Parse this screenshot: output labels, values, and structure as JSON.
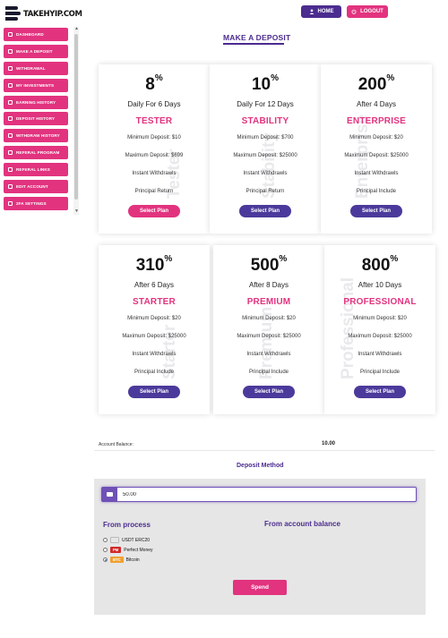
{
  "header": {
    "logo_text": "TAKEHYIP.COM",
    "home_label": "HOME",
    "logout_label": "LOGOUT"
  },
  "sidebar": {
    "items": [
      {
        "label": "DASHBOARD",
        "icon": "dashboard-icon"
      },
      {
        "label": "MAKE A DEPOSIT",
        "icon": "deposit-icon"
      },
      {
        "label": "WITHDRAWAL",
        "icon": "withdrawal-icon"
      },
      {
        "label": "MY INVESTMENTS",
        "icon": "investments-icon"
      },
      {
        "label": "EARNING HISTORY",
        "icon": "earning-icon"
      },
      {
        "label": "DEPOSIT HISTORY",
        "icon": "history-icon"
      },
      {
        "label": "WITHDRAW HISTORY",
        "icon": "history-icon"
      },
      {
        "label": "REFERAL PROGRAM",
        "icon": "referral-icon"
      },
      {
        "label": "REFERAL LINKS",
        "icon": "link-icon"
      },
      {
        "label": "EDIT ACCOUNT",
        "icon": "edit-icon"
      },
      {
        "label": "2FA SETTINGS",
        "icon": "lock-icon"
      }
    ]
  },
  "page_title": "MAKE A DEPOSIT",
  "plans": [
    {
      "percent": "8",
      "duration": "Daily For 6 Days",
      "name": "TESTER",
      "min": "Minimum Deposit: $10",
      "max": "Maximum Deposit: $699",
      "withdraw": "Instant Withdrawls",
      "principal": "Principal Return",
      "button": "Select Plan",
      "watermark": "Tester",
      "button_color": "#e2337f"
    },
    {
      "percent": "10",
      "duration": "Daily For 12 Days",
      "name": "STABILITY",
      "min": "Minimum Deposit: $700",
      "max": "Maximum Deposit: $25000",
      "withdraw": "Instant Withdrawls",
      "principal": "Principal Return",
      "button": "Select Plan",
      "watermark": "Stability",
      "button_color": "#4b3a9b"
    },
    {
      "percent": "200",
      "duration": "After 4 Days",
      "name": "ENTERPRISE",
      "min": "Minimum Deposit: $20",
      "max": "Maximum Deposit: $25000",
      "withdraw": "Instant Withdrawls",
      "principal": "Principal Include",
      "button": "Select Plan",
      "watermark": "Enterprise",
      "button_color": "#4b3a9b"
    },
    {
      "percent": "310",
      "duration": "After 6 Days",
      "name": "STARTER",
      "min": "Minimum Deposit: $20",
      "max": "Maximum Deposit: $25000",
      "withdraw": "Instant Withdrawls",
      "principal": "Principal Include",
      "button": "Select Plan",
      "watermark": "Starter",
      "button_color": "#4b3a9b"
    },
    {
      "percent": "500",
      "duration": "After 8 Days",
      "name": "PREMIUM",
      "min": "Minimum Deposit: $20",
      "max": "Maximum Deposit: $25000",
      "withdraw": "Instant Withdrawls",
      "principal": "Principal Include",
      "button": "Select Plan",
      "watermark": "Premium",
      "button_color": "#4b3a9b"
    },
    {
      "percent": "800",
      "duration": "After 10 Days",
      "name": "PROFESSIONAL",
      "min": "Minimum Deposit: $20",
      "max": "Maximum Deposit: $25000",
      "withdraw": "Instant Withdrawls",
      "principal": "Principal Include",
      "button": "Select Plan",
      "watermark": "Professional",
      "button_color": "#4b3a9b"
    }
  ],
  "percent_sign": "%",
  "account": {
    "label": "Account Balance:",
    "value": "10.00"
  },
  "deposit_method": {
    "title": "Deposit Method",
    "amount_value": "50.00",
    "from_process_title": "From process",
    "from_balance_title": "From account balance",
    "options": [
      {
        "badge": "",
        "label": "USDT ERC20",
        "checked": false,
        "badge_color": "#e6e6e6"
      },
      {
        "badge": "PM",
        "label": "Perfect Money",
        "checked": false,
        "badge_color": "#d22a2a"
      },
      {
        "badge": "BTC",
        "label": "Bitcoin",
        "checked": true,
        "badge_color": "#f0a030"
      }
    ],
    "spend_label": "Spend"
  },
  "colors": {
    "accent_pink": "#e2337f",
    "accent_purple": "#4b2c8f"
  }
}
